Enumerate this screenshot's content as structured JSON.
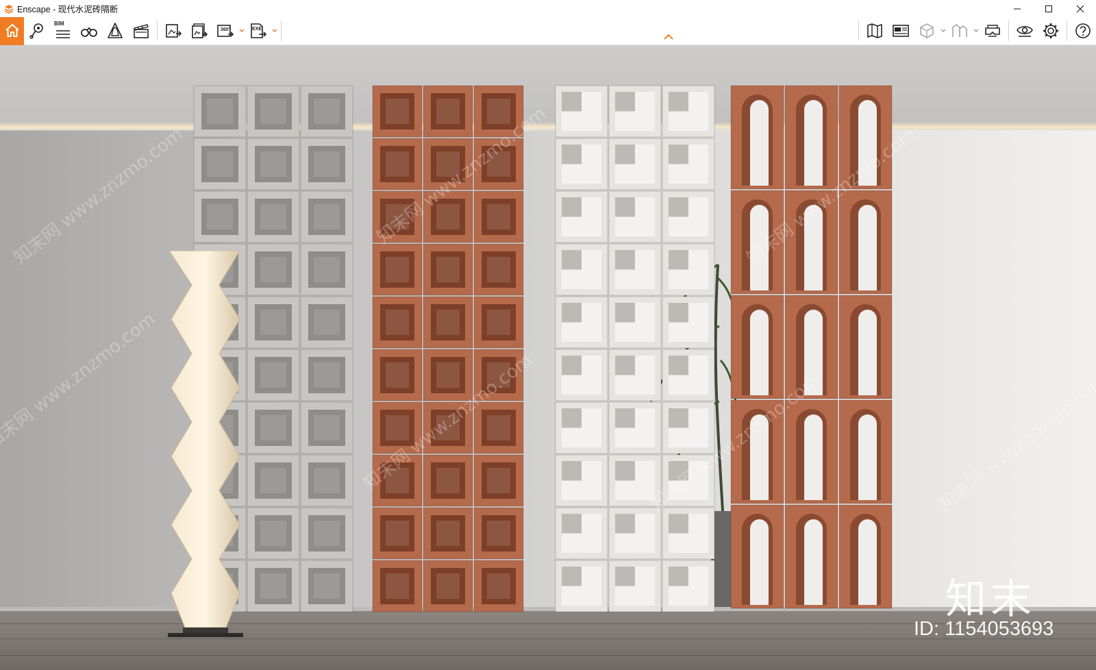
{
  "window": {
    "title": "Enscape - 现代水泥砖隔断",
    "logo_icon": "enscape-logo-icon",
    "controls": [
      "minimize",
      "maximize",
      "close"
    ]
  },
  "toolbar": {
    "accent_color": "#f07d24",
    "bim_label": "BIM",
    "panorama_label": "360°",
    "exe_label": "EXE",
    "left_group": [
      {
        "name": "home-icon",
        "label": "Home"
      },
      {
        "name": "map-pin-icon",
        "label": "Sun/Location"
      },
      {
        "name": "bim-list-icon",
        "label": "BIM"
      },
      {
        "name": "binoculars-icon",
        "label": "Views"
      },
      {
        "name": "bell-icon",
        "label": "Assets"
      },
      {
        "name": "clapper-icon",
        "label": "Video Editor"
      },
      {
        "name": "screenshot-export-icon",
        "label": "Render"
      },
      {
        "name": "batch-export-icon",
        "label": "Batch Render"
      },
      {
        "name": "panorama-360-icon",
        "label": "Panorama"
      },
      {
        "name": "exe-export-icon",
        "label": "Export EXE"
      }
    ],
    "right_group": [
      {
        "name": "book-map-icon",
        "label": "Map"
      },
      {
        "name": "atlas-panel-icon",
        "label": "Atlas"
      },
      {
        "name": "cube-icon",
        "label": "Model"
      },
      {
        "name": "collaboration-icon",
        "label": "Collaboration"
      },
      {
        "name": "vr-headset-icon",
        "label": "VR"
      },
      {
        "name": "eye-icon",
        "label": "Visual Settings"
      },
      {
        "name": "gear-icon",
        "label": "Settings"
      },
      {
        "name": "help-icon",
        "label": "Help"
      }
    ]
  },
  "scene": {
    "brand_mark": "知末",
    "id_text": "ID: 1154053693",
    "watermark_text": "知末网 www.znzmo.com",
    "colors": {
      "white_block": "#e6e4e1",
      "terracotta_block": "#b56a4c",
      "wall_light": "#efeeec"
    }
  }
}
